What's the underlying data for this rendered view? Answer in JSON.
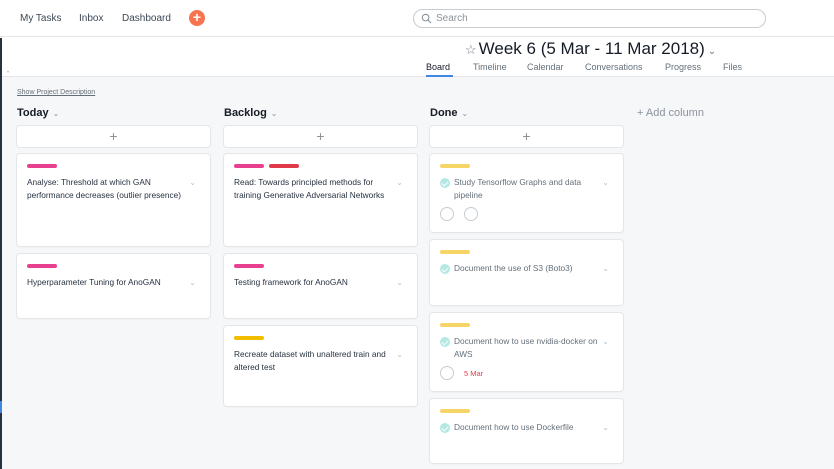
{
  "nav": {
    "my_tasks": "My Tasks",
    "inbox": "Inbox",
    "dashboard": "Dashboard",
    "add_icon": "plus-icon",
    "search_placeholder": "Search"
  },
  "project": {
    "title": "Week 6 (5 Mar - 11 Mar 2018)",
    "tabs": [
      "Board",
      "Timeline",
      "Calendar",
      "Conversations",
      "Progress",
      "Files"
    ],
    "active_tab": "Board",
    "show_description": "Show Project Description"
  },
  "board": {
    "add_column": "+ Add column",
    "columns": [
      {
        "title": "Today",
        "cards": [
          {
            "text": "Analyse: Threshold at which GAN performance decreases (outlier presence)",
            "tags": [
              "#e8408f"
            ]
          },
          {
            "text": "Hyperparameter Tuning for AnoGAN",
            "tags": [
              "#e8408f"
            ]
          }
        ]
      },
      {
        "title": "Backlog",
        "cards": [
          {
            "text": "Read: Towards principled methods for training Generative Adversarial Networks",
            "tags": [
              "#e8408f",
              "#e03a48"
            ]
          },
          {
            "text": "Testing framework for AnoGAN",
            "tags": [
              "#e8408f"
            ]
          },
          {
            "text": "Recreate dataset with unaltered train and altered test",
            "tags": [
              "#f2bd00"
            ]
          }
        ]
      },
      {
        "title": "Done",
        "cards": [
          {
            "text": "Study Tensorflow Graphs and data pipeline",
            "tags": [
              "#f5d565"
            ],
            "completed": true
          },
          {
            "text": "Document the use of S3 (Boto3)",
            "tags": [
              "#f5d565"
            ],
            "completed": true
          },
          {
            "text": "Document how to use nvidia-docker on AWS",
            "tags": [
              "#f5d565"
            ],
            "completed": true,
            "due": "5 Mar"
          },
          {
            "text": "Document how to use Dockerfile",
            "tags": [
              "#f5d565"
            ],
            "completed": true
          }
        ]
      }
    ]
  },
  "colors": {
    "accent": "#4186e0",
    "add_button": "#f8744f",
    "completed_check": "#b3e8e3",
    "due_date": "#e8384f"
  }
}
